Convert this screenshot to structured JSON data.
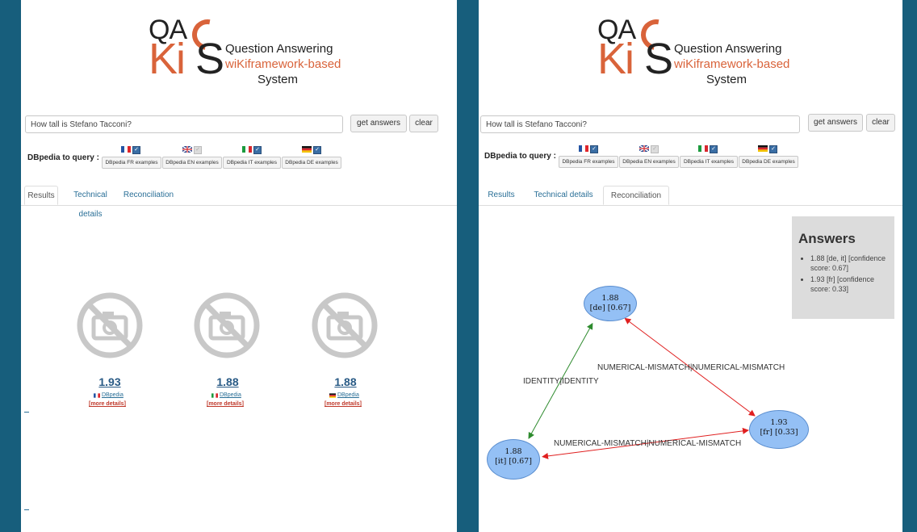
{
  "logo": {
    "qa": "QA",
    "kis": "Ki",
    "s": "S",
    "line1": "Question Answering",
    "line2": "wiKiframework-based",
    "line3": "System"
  },
  "search": {
    "value": "How tall is Stefano Tacconi?"
  },
  "buttons": {
    "get_answers": "get answers",
    "clear": "clear"
  },
  "dbpedia": {
    "label": "DBpedia to query :",
    "options": [
      {
        "flag": "fr",
        "checked": true,
        "label": "DBpedia FR examples"
      },
      {
        "flag": "en",
        "checked": false,
        "label": "DBpedia EN examples"
      },
      {
        "flag": "it",
        "checked": true,
        "label": "DBpedia IT examples"
      },
      {
        "flag": "de",
        "checked": true,
        "label": "DBpedia DE examples"
      }
    ]
  },
  "tabs": [
    "Results",
    "Technical details",
    "Reconciliation"
  ],
  "left_active_tab": "Results",
  "right_active_tab": "Reconciliation",
  "results": [
    {
      "value": "1.93",
      "source": "DBpedia",
      "flag": "fr",
      "more": "[more details]"
    },
    {
      "value": "1.88",
      "source": "DBpedia",
      "flag": "it",
      "more": "[more details]"
    },
    {
      "value": "1.88",
      "source": "DBpedia",
      "flag": "de",
      "more": "[more details]"
    }
  ],
  "answers": {
    "title": "Answers",
    "items": [
      "1.88 [de, it] [confidence score: 0.67]",
      "1.93 [fr] [confidence score: 0.33]"
    ]
  },
  "graph": {
    "nodes": [
      {
        "id": "de",
        "line1": "1.88",
        "line2": "[de] [0.67]"
      },
      {
        "id": "it",
        "line1": "1.88",
        "line2": "[it] [0.67]"
      },
      {
        "id": "fr",
        "line1": "1.93",
        "line2": "[fr] [0.33]"
      }
    ],
    "edges": [
      {
        "from": "de",
        "to": "it",
        "label": "IDENTITY|IDENTITY",
        "color": "#2e8b2e"
      },
      {
        "from": "de",
        "to": "fr",
        "label": "NUMERICAL-MISMATCH|NUMERICAL-MISMATCH",
        "color": "#e02020"
      },
      {
        "from": "it",
        "to": "fr",
        "label": "NUMERICAL-MISMATCH|NUMERICAL-MISMATCH",
        "color": "#e02020"
      }
    ]
  },
  "colors": {
    "sidebar": "#175e7c",
    "accent": "#d9633a",
    "link": "#2a6f97",
    "node_fill": "#94c0f5"
  }
}
